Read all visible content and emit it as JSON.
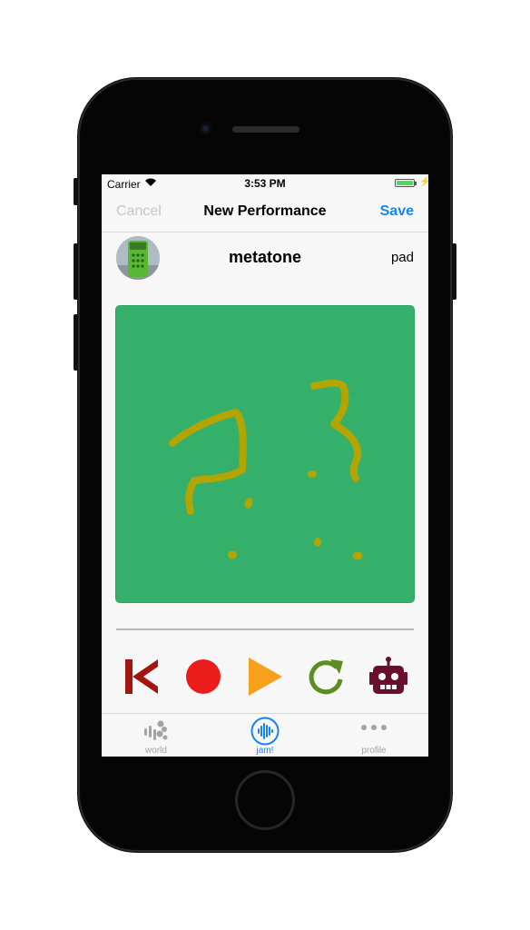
{
  "status_bar": {
    "carrier": "Carrier",
    "time": "3:53 PM",
    "battery_level": 1.0,
    "battery_color": "#4cd964"
  },
  "navbar": {
    "cancel_label": "Cancel",
    "title": "New Performance",
    "save_label": "Save"
  },
  "performance": {
    "name": "metatone",
    "instrument": "pad"
  },
  "pad": {
    "background_color": "#35b06b",
    "stroke_color": "#b4a400"
  },
  "controls": [
    {
      "name": "rewind-button",
      "icon": "skip-back-icon",
      "color": "#a3160f"
    },
    {
      "name": "record-button",
      "icon": "record-icon",
      "color": "#ec1c1c"
    },
    {
      "name": "play-button",
      "icon": "play-icon",
      "color": "#f7a01b"
    },
    {
      "name": "reload-button",
      "icon": "refresh-icon",
      "color": "#5b8d21"
    },
    {
      "name": "robot-button",
      "icon": "robot-icon",
      "color": "#6a0f2b"
    }
  ],
  "tabbar": {
    "tabs": [
      {
        "label": "world",
        "icon": "world-icon"
      },
      {
        "label": "jam!",
        "icon": "jam-icon",
        "active": true
      },
      {
        "label": "profile",
        "icon": "more-icon"
      }
    ],
    "accent": "#1a82f7"
  }
}
